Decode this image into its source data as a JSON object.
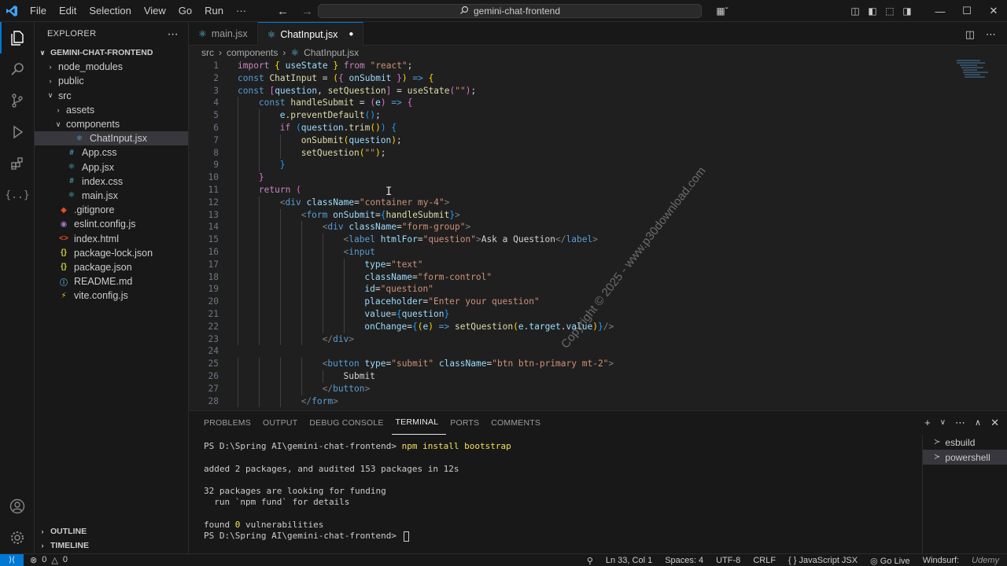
{
  "titlebar": {
    "menu": [
      "File",
      "Edit",
      "Selection",
      "View",
      "Go",
      "Run",
      "···"
    ],
    "search_text": "gemini-chat-frontend"
  },
  "explorer": {
    "header": "EXPLORER",
    "project": "GEMINI-CHAT-FRONTEND",
    "items": [
      {
        "label": "node_modules",
        "kind": "folder",
        "depth": 1,
        "open": false
      },
      {
        "label": "public",
        "kind": "folder",
        "depth": 1,
        "open": false
      },
      {
        "label": "src",
        "kind": "folder",
        "depth": 1,
        "open": true
      },
      {
        "label": "assets",
        "kind": "folder",
        "depth": 2,
        "open": false
      },
      {
        "label": "components",
        "kind": "folder",
        "depth": 2,
        "open": true
      },
      {
        "label": "ChatInput.jsx",
        "kind": "react",
        "depth": 3,
        "selected": true
      },
      {
        "label": "App.css",
        "kind": "css",
        "depth": 2
      },
      {
        "label": "App.jsx",
        "kind": "react",
        "depth": 2
      },
      {
        "label": "index.css",
        "kind": "css",
        "depth": 2
      },
      {
        "label": "main.jsx",
        "kind": "react",
        "depth": 2
      },
      {
        "label": ".gitignore",
        "kind": "git",
        "depth": 1
      },
      {
        "label": "eslint.config.js",
        "kind": "eslint",
        "depth": 1
      },
      {
        "label": "index.html",
        "kind": "html",
        "depth": 1
      },
      {
        "label": "package-lock.json",
        "kind": "json",
        "depth": 1
      },
      {
        "label": "package.json",
        "kind": "json",
        "depth": 1
      },
      {
        "label": "README.md",
        "kind": "info",
        "depth": 1
      },
      {
        "label": "vite.config.js",
        "kind": "vite",
        "depth": 1
      }
    ],
    "outline": "OUTLINE",
    "timeline": "TIMELINE"
  },
  "tabs": [
    {
      "label": "main.jsx",
      "active": false
    },
    {
      "label": "ChatInput.jsx",
      "active": true,
      "dirty": true
    }
  ],
  "breadcrumb": [
    "src",
    "components",
    "ChatInput.jsx"
  ],
  "code": {
    "lines": [
      {
        "n": "1",
        "indent": 0,
        "tokens": [
          [
            "kw",
            "import"
          ],
          [
            "tx",
            " "
          ],
          [
            "br1",
            "{"
          ],
          [
            "tx",
            " "
          ],
          [
            "vr",
            "useState"
          ],
          [
            "tx",
            " "
          ],
          [
            "br1",
            "}"
          ],
          [
            "tx",
            " "
          ],
          [
            "kw",
            "from"
          ],
          [
            "tx",
            " "
          ],
          [
            "st",
            "\"react\""
          ],
          [
            "tx",
            ";"
          ]
        ]
      },
      {
        "n": "2",
        "indent": 0,
        "tokens": [
          [
            "kb",
            "const"
          ],
          [
            "tx",
            " "
          ],
          [
            "fn",
            "ChatInput"
          ],
          [
            "tx",
            " = "
          ],
          [
            "br1",
            "("
          ],
          [
            "br2",
            "{"
          ],
          [
            "tx",
            " "
          ],
          [
            "vr",
            "onSubmit"
          ],
          [
            "tx",
            " "
          ],
          [
            "br2",
            "}"
          ],
          [
            "br1",
            ")"
          ],
          [
            "tx",
            " "
          ],
          [
            "kb",
            "=>"
          ],
          [
            "tx",
            " "
          ],
          [
            "br1",
            "{"
          ]
        ]
      },
      {
        "n": "3",
        "indent": 0,
        "tokens": [
          [
            "kb",
            "const"
          ],
          [
            "tx",
            " "
          ],
          [
            "br2",
            "["
          ],
          [
            "vr",
            "question"
          ],
          [
            "tx",
            ", "
          ],
          [
            "fn",
            "setQuestion"
          ],
          [
            "br2",
            "]"
          ],
          [
            "tx",
            " = "
          ],
          [
            "fn",
            "useState"
          ],
          [
            "br2",
            "("
          ],
          [
            "st",
            "\"\""
          ],
          [
            "br2",
            ")"
          ],
          [
            "tx",
            ";"
          ]
        ]
      },
      {
        "n": "4",
        "indent": 1,
        "tokens": [
          [
            "kb",
            "const"
          ],
          [
            "tx",
            " "
          ],
          [
            "fn",
            "handleSubmit"
          ],
          [
            "tx",
            " = "
          ],
          [
            "br2",
            "("
          ],
          [
            "vr",
            "e"
          ],
          [
            "br2",
            ")"
          ],
          [
            "tx",
            " "
          ],
          [
            "kb",
            "=>"
          ],
          [
            "tx",
            " "
          ],
          [
            "br2",
            "{"
          ]
        ]
      },
      {
        "n": "5",
        "indent": 2,
        "tokens": [
          [
            "vr",
            "e"
          ],
          [
            "tx",
            "."
          ],
          [
            "fn",
            "preventDefault"
          ],
          [
            "br3",
            "()"
          ],
          [
            "tx",
            ";"
          ]
        ]
      },
      {
        "n": "6",
        "indent": 2,
        "tokens": [
          [
            "kw",
            "if"
          ],
          [
            "tx",
            " "
          ],
          [
            "br3",
            "("
          ],
          [
            "vr",
            "question"
          ],
          [
            "tx",
            "."
          ],
          [
            "fn",
            "trim"
          ],
          [
            "br1",
            "()"
          ],
          [
            "br3",
            ")"
          ],
          [
            "tx",
            " "
          ],
          [
            "br3",
            "{"
          ]
        ]
      },
      {
        "n": "7",
        "indent": 3,
        "tokens": [
          [
            "fn",
            "onSubmit"
          ],
          [
            "br1",
            "("
          ],
          [
            "vr",
            "question"
          ],
          [
            "br1",
            ")"
          ],
          [
            "tx",
            ";"
          ]
        ]
      },
      {
        "n": "8",
        "indent": 3,
        "tokens": [
          [
            "fn",
            "setQuestion"
          ],
          [
            "br1",
            "("
          ],
          [
            "st",
            "\"\""
          ],
          [
            "br1",
            ")"
          ],
          [
            "tx",
            ";"
          ]
        ]
      },
      {
        "n": "9",
        "indent": 2,
        "tokens": [
          [
            "br3",
            "}"
          ]
        ]
      },
      {
        "n": "10",
        "indent": 1,
        "tokens": [
          [
            "br2",
            "}"
          ]
        ]
      },
      {
        "n": "11",
        "indent": 1,
        "tokens": [
          [
            "kw",
            "return"
          ],
          [
            "tx",
            " "
          ],
          [
            "br2",
            "("
          ]
        ]
      },
      {
        "n": "12",
        "indent": 2,
        "tokens": [
          [
            "tg",
            "<"
          ],
          [
            "tn",
            "div"
          ],
          [
            "tx",
            " "
          ],
          [
            "at",
            "className"
          ],
          [
            "tx",
            "="
          ],
          [
            "st",
            "\"container my-4\""
          ],
          [
            "tg",
            ">"
          ]
        ]
      },
      {
        "n": "13",
        "indent": 3,
        "tokens": [
          [
            "tg",
            "<"
          ],
          [
            "tn",
            "form"
          ],
          [
            "tx",
            " "
          ],
          [
            "at",
            "onSubmit"
          ],
          [
            "tx",
            "="
          ],
          [
            "br3",
            "{"
          ],
          [
            "fn",
            "handleSubmit"
          ],
          [
            "br3",
            "}"
          ],
          [
            "tg",
            ">"
          ]
        ]
      },
      {
        "n": "14",
        "indent": 4,
        "tokens": [
          [
            "tg",
            "<"
          ],
          [
            "tn",
            "div"
          ],
          [
            "tx",
            " "
          ],
          [
            "at",
            "className"
          ],
          [
            "tx",
            "="
          ],
          [
            "st",
            "\"form-group\""
          ],
          [
            "tg",
            ">"
          ]
        ]
      },
      {
        "n": "15",
        "indent": 5,
        "tokens": [
          [
            "tg",
            "<"
          ],
          [
            "tn",
            "label"
          ],
          [
            "tx",
            " "
          ],
          [
            "at",
            "htmlFor"
          ],
          [
            "tx",
            "="
          ],
          [
            "st",
            "\"question\""
          ],
          [
            "tg",
            ">"
          ],
          [
            "tx",
            "Ask a Question"
          ],
          [
            "tg",
            "</"
          ],
          [
            "tn",
            "label"
          ],
          [
            "tg",
            ">"
          ]
        ]
      },
      {
        "n": "16",
        "indent": 5,
        "tokens": [
          [
            "tg",
            "<"
          ],
          [
            "tn",
            "input"
          ]
        ]
      },
      {
        "n": "17",
        "indent": 6,
        "tokens": [
          [
            "at",
            "type"
          ],
          [
            "tx",
            "="
          ],
          [
            "st",
            "\"text\""
          ]
        ]
      },
      {
        "n": "18",
        "indent": 6,
        "tokens": [
          [
            "at",
            "className"
          ],
          [
            "tx",
            "="
          ],
          [
            "st",
            "\"form-control\""
          ]
        ]
      },
      {
        "n": "19",
        "indent": 6,
        "tokens": [
          [
            "at",
            "id"
          ],
          [
            "tx",
            "="
          ],
          [
            "st",
            "\"question\""
          ]
        ]
      },
      {
        "n": "20",
        "indent": 6,
        "tokens": [
          [
            "at",
            "placeholder"
          ],
          [
            "tx",
            "="
          ],
          [
            "st",
            "\"Enter your question\""
          ]
        ]
      },
      {
        "n": "21",
        "indent": 6,
        "tokens": [
          [
            "at",
            "value"
          ],
          [
            "tx",
            "="
          ],
          [
            "br3",
            "{"
          ],
          [
            "vr",
            "question"
          ],
          [
            "br3",
            "}"
          ]
        ]
      },
      {
        "n": "22",
        "indent": 6,
        "tokens": [
          [
            "at",
            "onChange"
          ],
          [
            "tx",
            "="
          ],
          [
            "br3",
            "{"
          ],
          [
            "br1",
            "("
          ],
          [
            "vr",
            "e"
          ],
          [
            "br1",
            ")"
          ],
          [
            "tx",
            " "
          ],
          [
            "kb",
            "=>"
          ],
          [
            "tx",
            " "
          ],
          [
            "fn",
            "setQuestion"
          ],
          [
            "br1",
            "("
          ],
          [
            "vr",
            "e"
          ],
          [
            "tx",
            "."
          ],
          [
            "vr",
            "target"
          ],
          [
            "tx",
            "."
          ],
          [
            "vr",
            "value"
          ],
          [
            "br1",
            ")"
          ],
          [
            "br3",
            "}"
          ],
          [
            "tg",
            "/>"
          ]
        ]
      },
      {
        "n": "23",
        "indent": 4,
        "tokens": [
          [
            "tg",
            "</"
          ],
          [
            "tn",
            "div"
          ],
          [
            "tg",
            ">"
          ]
        ]
      },
      {
        "n": "24",
        "indent": 0,
        "tokens": []
      },
      {
        "n": "25",
        "indent": 4,
        "tokens": [
          [
            "tg",
            "<"
          ],
          [
            "tn",
            "button"
          ],
          [
            "tx",
            " "
          ],
          [
            "at",
            "type"
          ],
          [
            "tx",
            "="
          ],
          [
            "st",
            "\"submit\""
          ],
          [
            "tx",
            " "
          ],
          [
            "at",
            "className"
          ],
          [
            "tx",
            "="
          ],
          [
            "st",
            "\"btn btn-primary mt-2\""
          ],
          [
            "tg",
            ">"
          ]
        ]
      },
      {
        "n": "26",
        "indent": 5,
        "tokens": [
          [
            "tx",
            "Submit"
          ]
        ]
      },
      {
        "n": "27",
        "indent": 4,
        "tokens": [
          [
            "tg",
            "</"
          ],
          [
            "tn",
            "button"
          ],
          [
            "tg",
            ">"
          ]
        ]
      },
      {
        "n": "28",
        "indent": 3,
        "tokens": [
          [
            "tg",
            "</"
          ],
          [
            "tn",
            "form"
          ],
          [
            "tg",
            ">"
          ]
        ]
      }
    ]
  },
  "watermark": "Copyright © 2025 - www.p30download.com",
  "panel": {
    "tabs": [
      "PROBLEMS",
      "OUTPUT",
      "DEBUG CONSOLE",
      "TERMINAL",
      "PORTS",
      "COMMENTS"
    ],
    "active_tab": "TERMINAL",
    "terminal_lines": [
      {
        "prompt": "PS D:\\Spring AI\\gemini-chat-frontend> ",
        "cmd": "npm install bootstrap"
      },
      {
        "text": ""
      },
      {
        "text": "added 2 packages, and audited 153 packages in 12s"
      },
      {
        "text": ""
      },
      {
        "text": "32 packages are looking for funding"
      },
      {
        "text": "  run `npm fund` for details"
      },
      {
        "text": ""
      },
      {
        "pre": "found ",
        "num": "0",
        "post": " vulnerabilities"
      },
      {
        "prompt": "PS D:\\Spring AI\\gemini-chat-frontend> ",
        "cursor": true
      }
    ],
    "terminals": [
      {
        "label": "esbuild",
        "active": false
      },
      {
        "label": "powershell",
        "active": true
      }
    ]
  },
  "statusbar": {
    "errors": "0",
    "warnings": "0",
    "position": "Ln 33, Col 1",
    "spaces": "Spaces: 4",
    "encoding": "UTF-8",
    "eol": "CRLF",
    "language": "JavaScript JSX",
    "golive": "Go Live",
    "windsurf": "Windsurf:",
    "udemy": "Udemy"
  }
}
